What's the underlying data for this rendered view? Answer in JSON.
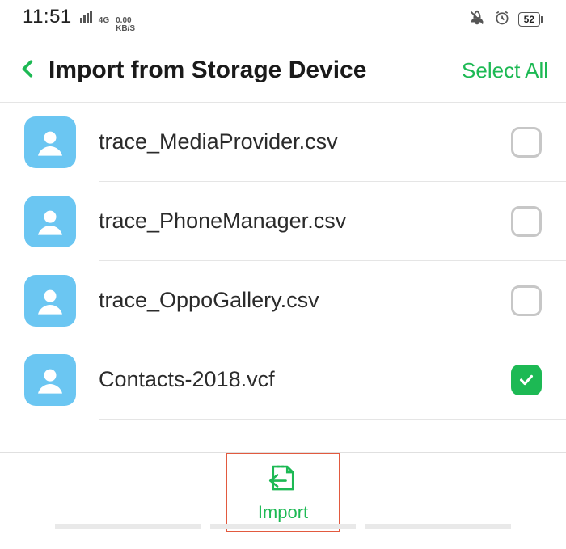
{
  "status": {
    "time": "11:51",
    "net_gen": "4G",
    "speed_top": "0.00",
    "speed_bottom": "KB/S",
    "battery": "52"
  },
  "header": {
    "title": "Import from Storage Device",
    "select_all": "Select All"
  },
  "files": [
    {
      "name": "trace_MediaProvider.csv",
      "checked": false
    },
    {
      "name": "trace_PhoneManager.csv",
      "checked": false
    },
    {
      "name": "trace_OppoGallery.csv",
      "checked": false
    },
    {
      "name": "Contacts-2018.vcf",
      "checked": true
    }
  ],
  "footer": {
    "import": "Import"
  }
}
